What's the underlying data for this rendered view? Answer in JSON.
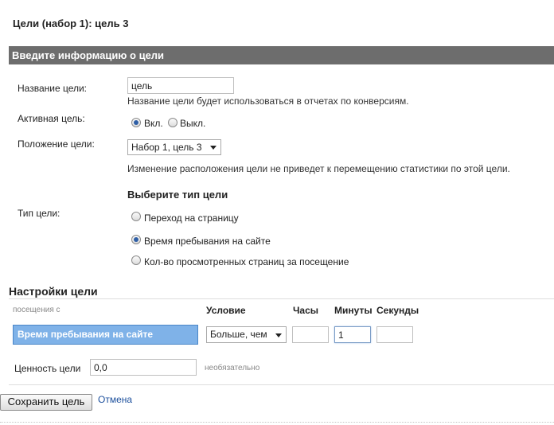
{
  "page": {
    "title": "Цели (набор 1): цель 3"
  },
  "section": {
    "header": "Введите информацию о цели"
  },
  "goal_name": {
    "label": "Название цели:",
    "value": "цель",
    "hint": "Название цели будет использоваться в отчетах по конверсиям."
  },
  "active": {
    "label": "Активная цель:",
    "on_label": "Вкл.",
    "off_label": "Выкл.",
    "selected": "on"
  },
  "position": {
    "label": "Положение цели:",
    "value": "Набор 1, цель 3",
    "hint": "Изменение расположения цели не приведет к перемещению статистики по этой цели."
  },
  "goal_type": {
    "heading": "Выберите тип цели",
    "label": "Тип цели:",
    "options": [
      {
        "label": "Переход на страницу",
        "checked": false
      },
      {
        "label": "Время пребывания на сайте",
        "checked": true
      },
      {
        "label": "Кол-во просмотренных страниц за посещение",
        "checked": false
      }
    ]
  },
  "settings": {
    "heading": "Настройки цели",
    "visits_label": "посещения с",
    "columns": {
      "condition": "Условие",
      "hours": "Часы",
      "minutes": "Минуты",
      "seconds": "Секунды"
    },
    "field_label": "Время пребывания на сайте",
    "condition_value": "Больше, чем",
    "hours_value": "",
    "minutes_value": "1",
    "seconds_value": "",
    "value_label": "Ценность цели",
    "value_value": "0,0",
    "optional_label": "необязательно"
  },
  "actions": {
    "save_label": "Сохранить цель",
    "cancel_label": "Отмена"
  },
  "colors": {
    "section_bar": "#6d6d6d",
    "highlight_field": "#7fb2e8",
    "link": "#1c4f9c"
  }
}
